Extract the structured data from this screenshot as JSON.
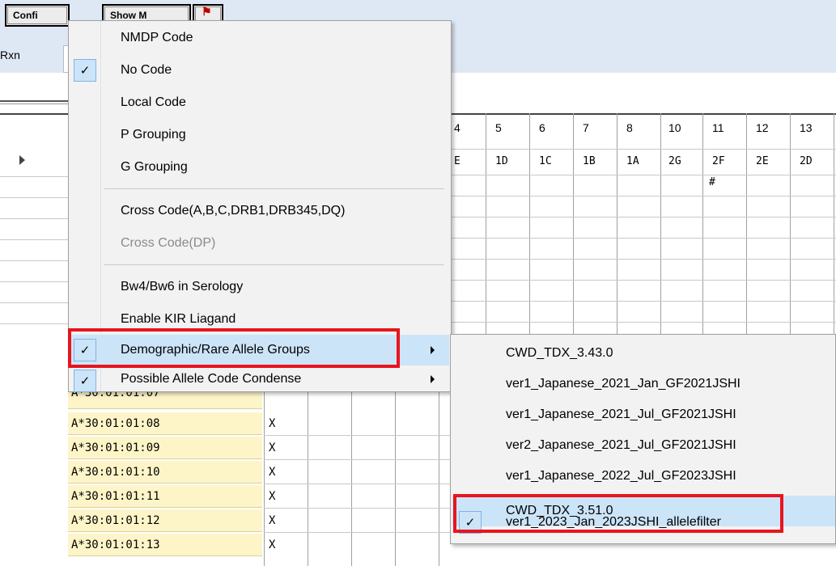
{
  "toolbar": {
    "config_label": "Confi",
    "show_label": "Show M",
    "flag_icon": "flag-icon",
    "rxn_label": "Rxn"
  },
  "grid": {
    "column_headers": [
      "4",
      "5",
      "6",
      "7",
      "8",
      "10",
      "11",
      "12",
      "13"
    ],
    "code_row": [
      "E",
      "1D",
      "1C",
      "1B",
      "1A",
      "2G",
      "2F",
      "2E",
      "2D"
    ],
    "hash_marker": "#",
    "partial_row_label": "A*30:01:01:07",
    "allele_rows": [
      {
        "allele": "A*30:01:01:08",
        "mark": "X"
      },
      {
        "allele": "A*30:01:01:09",
        "mark": "X"
      },
      {
        "allele": "A*30:01:01:10",
        "mark": "X"
      },
      {
        "allele": "A*30:01:01:11",
        "mark": "X"
      },
      {
        "allele": "A*30:01:01:12",
        "mark": "X"
      },
      {
        "allele": "A*30:01:01:13",
        "mark": "X"
      }
    ]
  },
  "context_menu": {
    "items": [
      {
        "label": "NMDP Code",
        "checked": false
      },
      {
        "label": "No Code",
        "checked": true
      },
      {
        "label": "Local Code",
        "checked": false
      },
      {
        "label": "P Grouping",
        "checked": false
      },
      {
        "label": "G Grouping",
        "checked": false
      },
      {
        "label": "Cross Code(A,B,C,DRB1,DRB345,DQ)",
        "checked": false
      },
      {
        "label": "Cross Code(DP)",
        "checked": false,
        "disabled": true
      },
      {
        "label": "Bw4/Bw6 in Serology",
        "checked": false
      },
      {
        "label": "Enable KIR Liagand",
        "checked": false
      },
      {
        "label": "Demographic/Rare Allele Groups",
        "checked": true,
        "has_submenu": true,
        "selected": true
      },
      {
        "label": "Possible Allele Code Condense",
        "checked": true,
        "has_submenu": true
      }
    ]
  },
  "submenu": {
    "items": [
      {
        "label": "CWD_TDX_3.43.0",
        "checked": false
      },
      {
        "label": "ver1_Japanese_2021_Jan_GF2021JSHI",
        "checked": false
      },
      {
        "label": "ver1_Japanese_2021_Jul_GF2021JSHI",
        "checked": false
      },
      {
        "label": "ver2_Japanese_2021_Jul_GF2021JSHI",
        "checked": false
      },
      {
        "label": "ver1_Japanese_2022_Jul_GF2023JSHI",
        "checked": false
      },
      {
        "label": "CWD_TDX_3.51.0",
        "checked": false,
        "selected": true
      },
      {
        "label": "ver1_2023_Jan_2023JSHI_allelefilter",
        "checked": true
      }
    ]
  },
  "colors": {
    "accent_highlight": "#cce4f7",
    "annotation_red": "#e8141e",
    "allele_cell_bg": "#fdf5c8"
  }
}
